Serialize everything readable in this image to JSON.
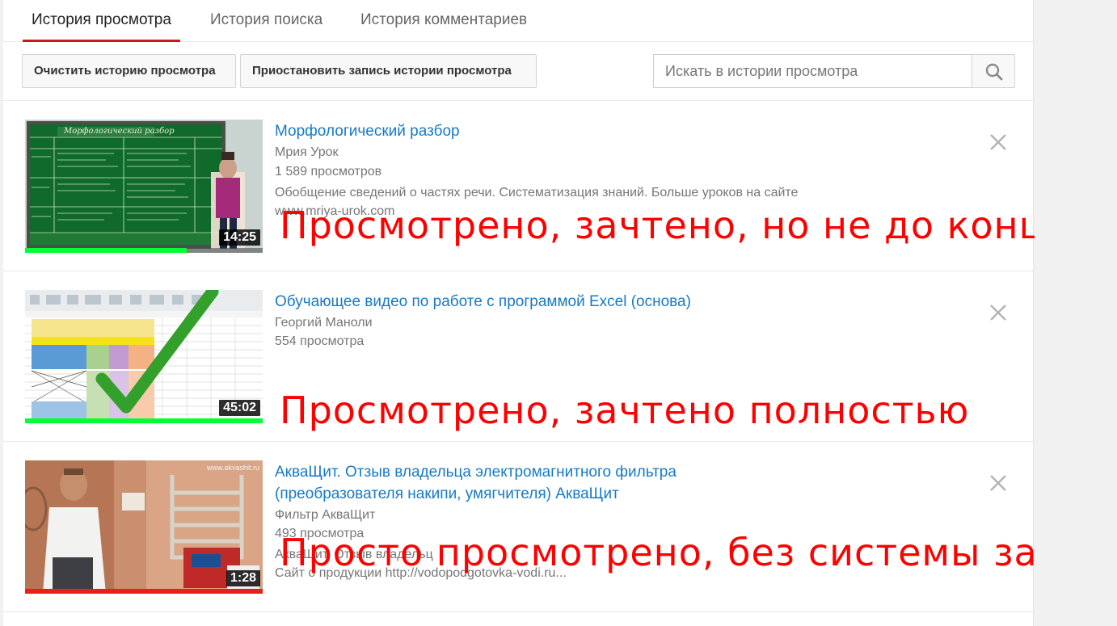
{
  "tabs": [
    {
      "label": "История просмотра",
      "active": true
    },
    {
      "label": "История поиска",
      "active": false
    },
    {
      "label": "История комментариев",
      "active": false
    }
  ],
  "toolbar": {
    "clear_label": "Очистить историю просмотра",
    "pause_label": "Приостановить запись истории просмотра",
    "search_placeholder": "Искать в истории просмотра",
    "search_icon": "search-icon"
  },
  "videos": [
    {
      "title": "Морфологический разбор",
      "channel": "Мрия Урок",
      "views": "1 589 просмотров",
      "description_line1": "Обобщение сведений о частях речи. Систематизация знаний. Больше уроков на сайте",
      "description_line2": "www.mriya-urok.com",
      "duration": "14:25",
      "progress": 0.68,
      "progress_color": "#00ff33",
      "thumb_board_title": "Морфологический разбор",
      "annotation": "Просмотрено, зачтено, но не до конца"
    },
    {
      "title": "Обучающее видео по работе с программой Excel (основа)",
      "channel": "Георгий Маноли",
      "views": "554 просмотра",
      "duration": "45:02",
      "progress": 1.0,
      "progress_color": "#00ff33",
      "annotation": "Просмотрено, зачтено полностью"
    },
    {
      "title_line1": "АкваЩит. Отзыв владельца электромагнитного фильтра",
      "title_line2": "(преобразователя накипи, умягчителя) АкваЩит",
      "channel": "Фильтр АкваЩит",
      "views": "493 просмотра",
      "description_line1": "АкваЩит. Отзыв владельц",
      "description_line2": "Сайт о продукции http://vodopodgotovka-vodi.ru...",
      "duration": "1:28",
      "progress": 1.0,
      "progress_color": "#e62117",
      "thumb_watermark": "www.akvashit.ru",
      "annotation": "Просто просмотрено, без системы зачета"
    }
  ],
  "colors": {
    "link": "#167ac6",
    "annotation": "#ff0000",
    "tab_underline": "#cc181e"
  }
}
